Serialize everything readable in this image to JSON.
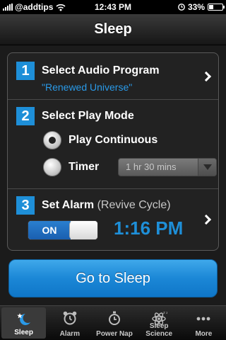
{
  "status_bar": {
    "carrier": "@addtips",
    "time": "12:43 PM",
    "battery": "33%"
  },
  "nav": {
    "title": "Sleep"
  },
  "steps": {
    "audio": {
      "number": "1",
      "title": "Select Audio Program",
      "program": "\"Renewed Universe\""
    },
    "play_mode": {
      "number": "2",
      "title": "Select Play Mode",
      "continuous_label": "Play Continuous",
      "continuous_selected": true,
      "timer_label": "Timer",
      "timer_selected": false,
      "timer_value": "1 hr 30 mins"
    },
    "alarm": {
      "number": "3",
      "title": "Set Alarm",
      "subtitle": "(Revive Cycle)",
      "toggle_label": "ON",
      "toggle_on": true,
      "time": "1:16 PM"
    }
  },
  "primary_button": {
    "label": "Go to Sleep"
  },
  "tabs": [
    {
      "label": "Sleep",
      "icon": "moon-star-icon",
      "active": true
    },
    {
      "label": "Alarm",
      "icon": "alarm-clock-icon",
      "active": false
    },
    {
      "label": "Power Nap",
      "icon": "stopwatch-icon",
      "active": false
    },
    {
      "label": "Sleep Science",
      "icon": "atom-icon",
      "active": false
    },
    {
      "label": "More",
      "icon": "more-dots-icon",
      "active": false
    }
  ],
  "colors": {
    "accent": "#1e8fd8",
    "background": "#1b1b1b"
  }
}
